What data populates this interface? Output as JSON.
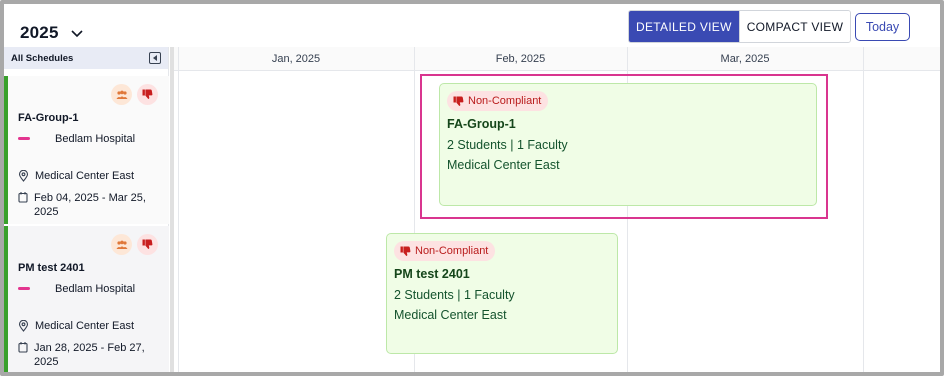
{
  "header": {
    "year": "2025",
    "views": {
      "detailed": "DETAILED VIEW",
      "compact": "COMPACT VIEW",
      "active": "detailed"
    },
    "today_label": "Today"
  },
  "sidebar": {
    "title": "All Schedules",
    "schedules": [
      {
        "name": "FA-Group-1",
        "hospital": "Bedlam Hospital",
        "location": "Medical Center East",
        "dates": "Feb 04, 2025 - Mar 25, 2025",
        "icons": [
          "group-icon",
          "thumbs-down-icon"
        ]
      },
      {
        "name": "PM test 2401",
        "hospital": "Bedlam Hospital",
        "location": "Medical Center East",
        "dates": "Jan 28, 2025 - Feb 27, 2025",
        "icons": [
          "group-icon",
          "thumbs-down-icon"
        ]
      }
    ]
  },
  "timeline": {
    "months": [
      "Jan, 2025",
      "Feb, 2025",
      "Mar, 2025"
    ],
    "events": [
      {
        "status": "Non-Compliant",
        "title": "FA-Group-1",
        "counts": "2 Students | 1 Faculty",
        "location": "Medical Center East",
        "selected": true
      },
      {
        "status": "Non-Compliant",
        "title": "PM test 2401",
        "counts": "2 Students | 1 Faculty",
        "location": "Medical Center East",
        "selected": false
      }
    ]
  },
  "colors": {
    "accent": "#3a4ab3",
    "status_bar": "#39a02b",
    "selected_outline": "#d9358f",
    "card_bg": "#f0fde6",
    "non_compliant": "#b91c1c"
  }
}
